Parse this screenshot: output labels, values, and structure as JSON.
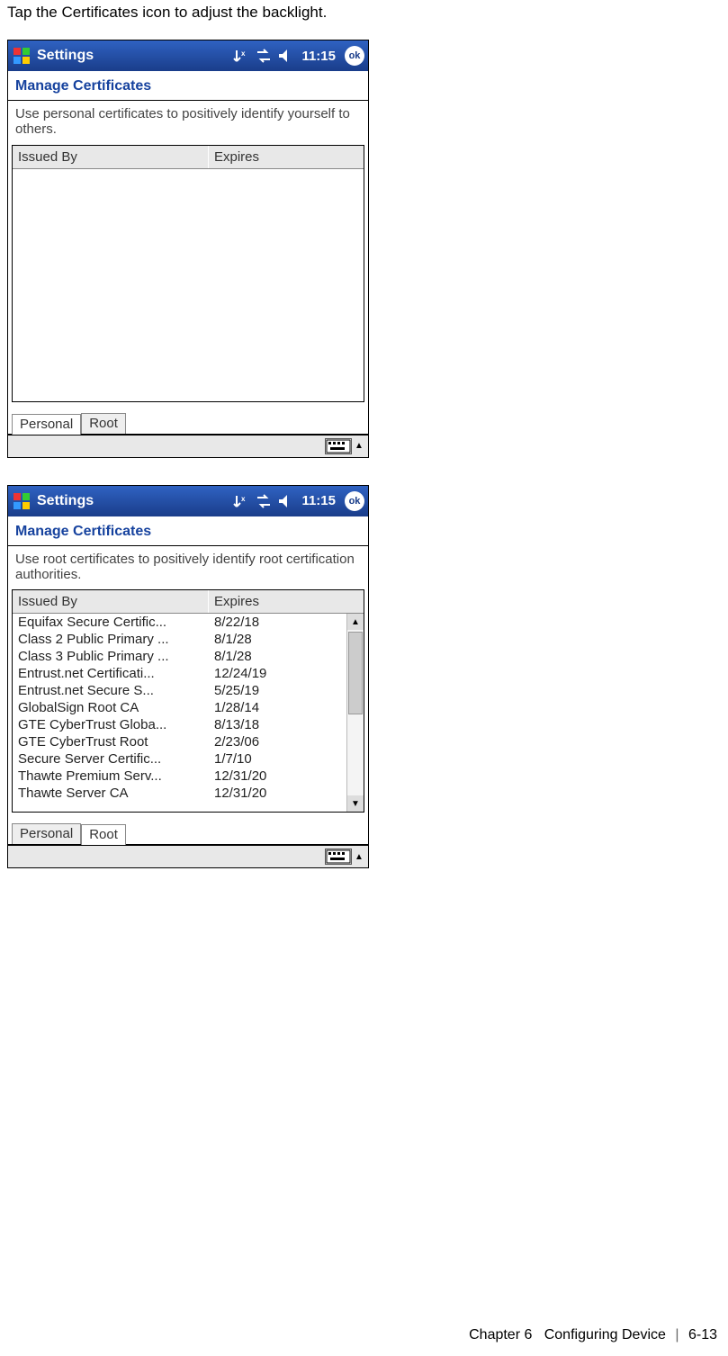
{
  "instruction": "Tap the Certificates icon to adjust the backlight.",
  "statusbar": {
    "app_title": "Settings",
    "time": "11:15",
    "ok_label": "ok"
  },
  "screen_personal": {
    "heading": "Manage Certificates",
    "description": "Use personal certificates to positively identify yourself to others.",
    "columns": {
      "issued_by": "Issued By",
      "expires": "Expires"
    },
    "rows": [],
    "tabs": {
      "personal": "Personal",
      "root": "Root",
      "active": "personal"
    }
  },
  "screen_root": {
    "heading": "Manage Certificates",
    "description": "Use root certificates to positively identify root certification authorities.",
    "columns": {
      "issued_by": "Issued By",
      "expires": "Expires"
    },
    "rows": [
      {
        "issued_by": "Equifax Secure Certific...",
        "expires": "8/22/18"
      },
      {
        "issued_by": "Class 2 Public Primary ...",
        "expires": "8/1/28"
      },
      {
        "issued_by": "Class 3 Public Primary ...",
        "expires": "8/1/28"
      },
      {
        "issued_by": "Entrust.net Certificati...",
        "expires": "12/24/19"
      },
      {
        "issued_by": "Entrust.net Secure S...",
        "expires": "5/25/19"
      },
      {
        "issued_by": "GlobalSign Root CA",
        "expires": "1/28/14"
      },
      {
        "issued_by": "GTE CyberTrust Globa...",
        "expires": "8/13/18"
      },
      {
        "issued_by": "GTE CyberTrust Root",
        "expires": "2/23/06"
      },
      {
        "issued_by": "Secure Server Certific...",
        "expires": "1/7/10"
      },
      {
        "issued_by": "Thawte Premium Serv...",
        "expires": "12/31/20"
      },
      {
        "issued_by": "Thawte Server CA",
        "expires": "12/31/20"
      }
    ],
    "tabs": {
      "personal": "Personal",
      "root": "Root",
      "active": "root"
    }
  },
  "footer": {
    "chapter": "Chapter 6",
    "title": "Configuring Device",
    "page": "6-13"
  }
}
